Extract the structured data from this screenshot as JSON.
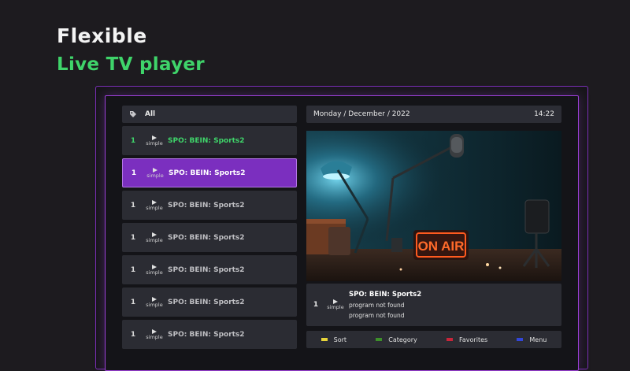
{
  "headline": {
    "line1": "Flexible",
    "line2": "Live TV player"
  },
  "channel_list": {
    "group_label": "All",
    "channels": [
      {
        "number": "1",
        "logo_text": "simple",
        "name": "SPO: BEIN: Sports2",
        "state": "active"
      },
      {
        "number": "1",
        "logo_text": "simple",
        "name": "SPO: BEIN: Sports2",
        "state": "selected"
      },
      {
        "number": "1",
        "logo_text": "simple",
        "name": "SPO: BEIN: Sports2",
        "state": "normal"
      },
      {
        "number": "1",
        "logo_text": "simple",
        "name": "SPO: BEIN: Sports2",
        "state": "normal"
      },
      {
        "number": "1",
        "logo_text": "simple",
        "name": "SPO: BEIN: Sports2",
        "state": "normal"
      },
      {
        "number": "1",
        "logo_text": "simple",
        "name": "SPO: BEIN: Sports2",
        "state": "normal"
      },
      {
        "number": "1",
        "logo_text": "simple",
        "name": "SPO: BEIN: Sports2",
        "state": "normal"
      }
    ]
  },
  "player": {
    "date": "Monday / December / 2022",
    "time": "14:22",
    "sign_text": "ON AIR"
  },
  "now_playing": {
    "number": "1",
    "logo_text": "simple",
    "channel": "SPO: BEIN: Sports2",
    "program_line1": "program not found",
    "program_line2": "program not found"
  },
  "legend": [
    {
      "label": "Sort",
      "color": "#e7d43a"
    },
    {
      "label": "Category",
      "color": "#3d8f2a"
    },
    {
      "label": "Favorites",
      "color": "#c8253a"
    },
    {
      "label": "Menu",
      "color": "#3246d8"
    }
  ],
  "colors": {
    "accent_green": "#3fd46a",
    "accent_purple": "#7b2fbf",
    "frame_purple": "#9b3fd6"
  }
}
